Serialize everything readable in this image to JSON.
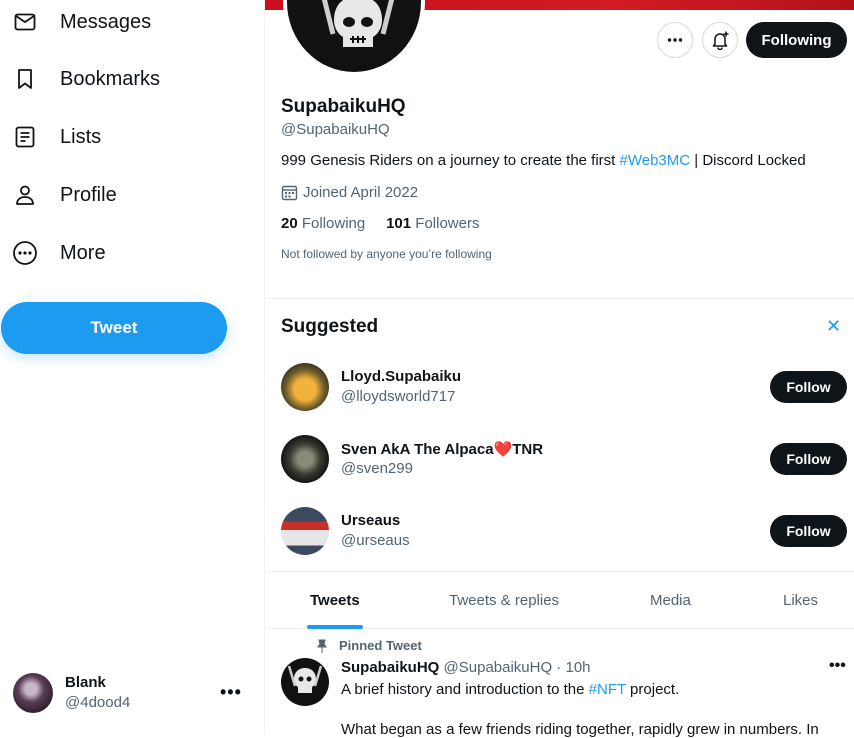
{
  "sidebar": {
    "items": [
      {
        "label": "Messages",
        "icon": "mail-icon"
      },
      {
        "label": "Bookmarks",
        "icon": "bookmark-icon"
      },
      {
        "label": "Lists",
        "icon": "list-icon"
      },
      {
        "label": "Profile",
        "icon": "person-icon"
      },
      {
        "label": "More",
        "icon": "more-circle-icon"
      }
    ],
    "tweet_label": "Tweet",
    "account": {
      "name": "Blank",
      "handle": "@4dood4"
    }
  },
  "profile": {
    "display_name": "SupabaikuHQ",
    "handle": "@SupabaikuHQ",
    "bio_prefix": "999 Genesis Riders on a journey to create the first ",
    "bio_link": "#Web3MC",
    "bio_suffix": " | Discord Locked",
    "joined": "Joined April 2022",
    "following_count": "20",
    "following_label": "Following",
    "followers_count": "101",
    "followers_label": "Followers",
    "not_followed": "Not followed by anyone you’re following",
    "following_button": "Following"
  },
  "suggested": {
    "title": "Suggested",
    "follow_label": "Follow",
    "users": [
      {
        "name": "Lloyd.Supabaiku",
        "handle": "@lloydsworld717"
      },
      {
        "name": "Sven AkA The Alpaca❤️TNR",
        "handle": "@sven299"
      },
      {
        "name": "Urseaus",
        "handle": "@urseaus"
      }
    ]
  },
  "tabs": [
    "Tweets",
    "Tweets & replies",
    "Media",
    "Likes"
  ],
  "tweet": {
    "pinned_label": "Pinned Tweet",
    "author": "SupabaikuHQ",
    "meta": "@SupabaikuHQ · 10h",
    "text_prefix": "A brief history and introduction to the ",
    "text_link": "#NFT",
    "text_suffix": " project.",
    "text2": "What began as a few friends riding together, rapidly grew in numbers. In"
  },
  "colors": {
    "accent": "#1d9bf0",
    "text": "#0f1419",
    "muted": "#536471",
    "banner": "#c8101a"
  }
}
